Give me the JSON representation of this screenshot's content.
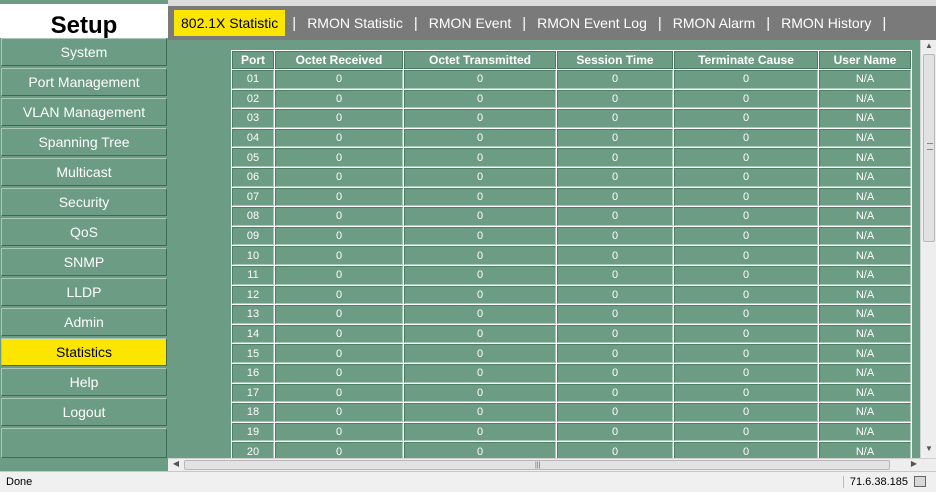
{
  "sidebar": {
    "title": "Setup",
    "items": [
      {
        "label": "System",
        "active": false
      },
      {
        "label": "Port Management",
        "active": false
      },
      {
        "label": "VLAN Management",
        "active": false
      },
      {
        "label": "Spanning Tree",
        "active": false
      },
      {
        "label": "Multicast",
        "active": false
      },
      {
        "label": "Security",
        "active": false
      },
      {
        "label": "QoS",
        "active": false
      },
      {
        "label": "SNMP",
        "active": false
      },
      {
        "label": "LLDP",
        "active": false
      },
      {
        "label": "Admin",
        "active": false
      },
      {
        "label": "Statistics",
        "active": true
      },
      {
        "label": "Help",
        "active": false
      },
      {
        "label": "Logout",
        "active": false
      }
    ]
  },
  "tabs": [
    {
      "label": "802.1X Statistic",
      "active": true
    },
    {
      "label": "RMON Statistic",
      "active": false
    },
    {
      "label": "RMON Event",
      "active": false
    },
    {
      "label": "RMON Event Log",
      "active": false
    },
    {
      "label": "RMON Alarm",
      "active": false
    },
    {
      "label": "RMON History",
      "active": false
    }
  ],
  "table": {
    "columns": [
      "Port",
      "Octet Received",
      "Octet Transmitted",
      "Session Time",
      "Terminate Cause",
      "User Name"
    ],
    "rows": [
      [
        "01",
        "0",
        "0",
        "0",
        "0",
        "N/A"
      ],
      [
        "02",
        "0",
        "0",
        "0",
        "0",
        "N/A"
      ],
      [
        "03",
        "0",
        "0",
        "0",
        "0",
        "N/A"
      ],
      [
        "04",
        "0",
        "0",
        "0",
        "0",
        "N/A"
      ],
      [
        "05",
        "0",
        "0",
        "0",
        "0",
        "N/A"
      ],
      [
        "06",
        "0",
        "0",
        "0",
        "0",
        "N/A"
      ],
      [
        "07",
        "0",
        "0",
        "0",
        "0",
        "N/A"
      ],
      [
        "08",
        "0",
        "0",
        "0",
        "0",
        "N/A"
      ],
      [
        "09",
        "0",
        "0",
        "0",
        "0",
        "N/A"
      ],
      [
        "10",
        "0",
        "0",
        "0",
        "0",
        "N/A"
      ],
      [
        "11",
        "0",
        "0",
        "0",
        "0",
        "N/A"
      ],
      [
        "12",
        "0",
        "0",
        "0",
        "0",
        "N/A"
      ],
      [
        "13",
        "0",
        "0",
        "0",
        "0",
        "N/A"
      ],
      [
        "14",
        "0",
        "0",
        "0",
        "0",
        "N/A"
      ],
      [
        "15",
        "0",
        "0",
        "0",
        "0",
        "N/A"
      ],
      [
        "16",
        "0",
        "0",
        "0",
        "0",
        "N/A"
      ],
      [
        "17",
        "0",
        "0",
        "0",
        "0",
        "N/A"
      ],
      [
        "18",
        "0",
        "0",
        "0",
        "0",
        "N/A"
      ],
      [
        "19",
        "0",
        "0",
        "0",
        "0",
        "N/A"
      ],
      [
        "20",
        "0",
        "0",
        "0",
        "0",
        "N/A"
      ]
    ]
  },
  "statusbar": {
    "text": "Done",
    "ip": "71.6.38.185",
    "zone_icon": "lock-icon"
  },
  "colors": {
    "panel_green": "#6c9c84",
    "highlight_yellow": "#fce600",
    "tabbar_gray": "#7a7a7a"
  }
}
